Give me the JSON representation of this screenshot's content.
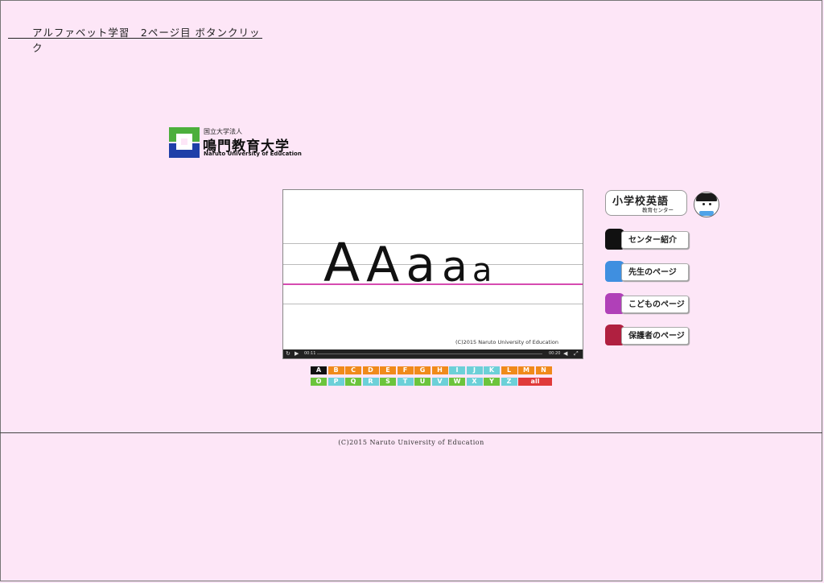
{
  "header": {
    "title": "アルファベット学習　2ページ目 ボタンクリック"
  },
  "logo": {
    "small": "国立大学法人",
    "name": "鳴門教育大学",
    "english": "Naruto University of Education"
  },
  "video": {
    "letters": [
      "A",
      "A",
      "a",
      "a",
      "a"
    ],
    "copyright": "(C)2015 Naruto University of Education",
    "time_current": "00:11",
    "time_total": "00:20"
  },
  "alphabet": {
    "row1": [
      "A",
      "B",
      "C",
      "D",
      "E",
      "F",
      "G",
      "H",
      "I",
      "J",
      "K",
      "L",
      "M",
      "N"
    ],
    "row2": [
      "O",
      "P",
      "Q",
      "R",
      "S",
      "T",
      "U",
      "V",
      "W",
      "X",
      "Y",
      "Z",
      "all"
    ],
    "selected": "A"
  },
  "side": {
    "title": "小学校英語",
    "subtitle": "教育センター",
    "menu": [
      {
        "label": "センター紹介",
        "color": "#111111"
      },
      {
        "label": "先生のページ",
        "color": "#3f8fe0"
      },
      {
        "label": "こどものページ",
        "color": "#b040b8"
      },
      {
        "label": "保護者のページ",
        "color": "#b02040"
      }
    ]
  },
  "footer": {
    "text": "(C)2015 Naruto University of Education"
  }
}
